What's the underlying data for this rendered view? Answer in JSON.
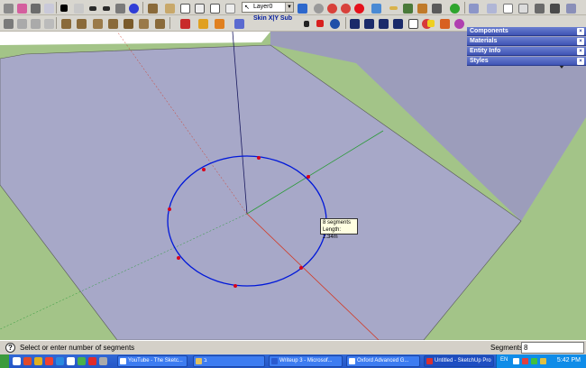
{
  "toolbar": {
    "layer_value": "Layer0",
    "text_tools": "Skin X|Y Sub"
  },
  "trays": [
    {
      "label": "Components"
    },
    {
      "label": "Materials"
    },
    {
      "label": "Entity Info"
    },
    {
      "label": "Styles"
    }
  ],
  "tooltip": {
    "line1": "8 segments",
    "line2": "Length: 2.34m"
  },
  "status": {
    "help_glyph": "?",
    "message": "Select or enter number of segments",
    "vcb_label": "Segments",
    "vcb_value": "8"
  },
  "taskbar": {
    "tasks": [
      {
        "label": "YouTube - The Sketc..."
      },
      {
        "label": "ב"
      },
      {
        "label": "Writeup 3 - Microsof..."
      },
      {
        "label": "Oxford Advanced G..."
      },
      {
        "label": "Untitled - SketchUp Pro"
      }
    ],
    "language": "EN",
    "clock": "5:42 PM"
  },
  "colors": {
    "ground_plane": "#a7a8c8",
    "grass": "#a3c488",
    "sky": "#ffffff",
    "wall": "#a3a4c0",
    "circle": "#0018d9",
    "endpoint": "#d9001c",
    "axis_red": "#d23a26",
    "axis_green": "#2a9a38",
    "axis_blue": "#1a1a60"
  }
}
